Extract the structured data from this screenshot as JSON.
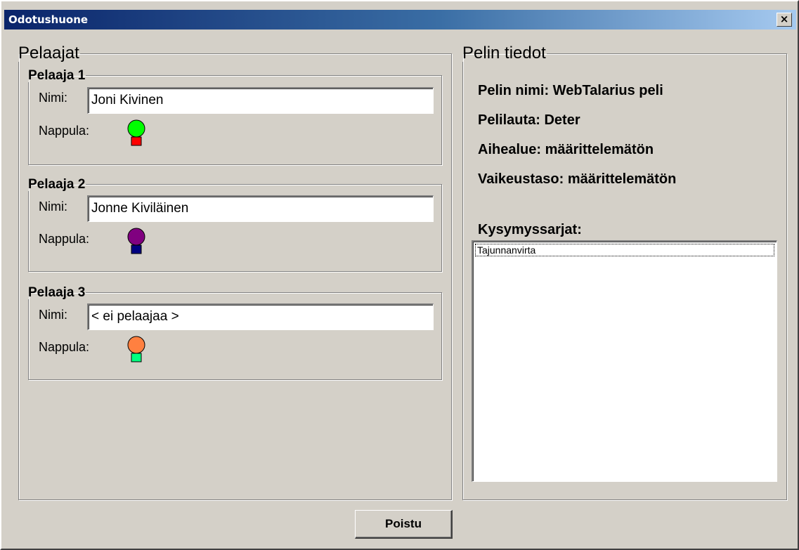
{
  "window": {
    "title": "Odotushuone",
    "close_label": "×"
  },
  "players_panel": {
    "legend": "Pelaajat",
    "players": [
      {
        "legend": "Pelaaja 1",
        "name_label": "Nimi:",
        "name_value": "Joni Kivinen",
        "token_label": "Nappula:",
        "token_head_color": "#00ff00",
        "token_base_color": "#ff0000"
      },
      {
        "legend": "Pelaaja 2",
        "name_label": "Nimi:",
        "name_value": "Jonne Kiviläinen",
        "token_label": "Nappula:",
        "token_head_color": "#800080",
        "token_base_color": "#000080"
      },
      {
        "legend": "Pelaaja 3",
        "name_label": "Nimi:",
        "name_value": "< ei pelaajaa >",
        "token_label": "Nappula:",
        "token_head_color": "#ff8040",
        "token_base_color": "#00ff80"
      }
    ]
  },
  "game_info": {
    "legend": "Pelin tiedot",
    "game_name": "Pelin nimi: WebTalarius peli",
    "board": "Pelilauta: Deter",
    "topic": "Aihealue: määrittelemätön",
    "difficulty": "Vaikeustaso: määrittelemätön",
    "question_sets_label": "Kysymyssarjat:",
    "question_sets": [
      "Tajunnanvirta"
    ]
  },
  "actions": {
    "exit_label": "Poistu"
  }
}
